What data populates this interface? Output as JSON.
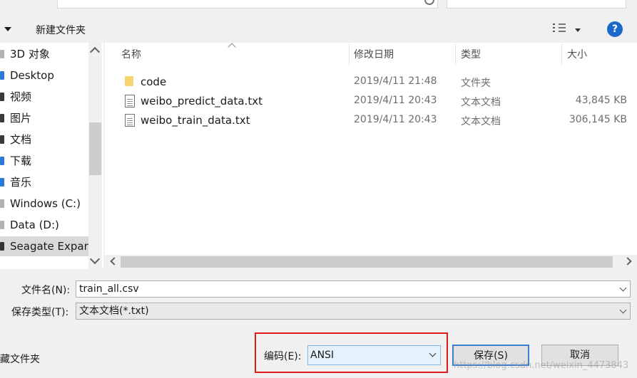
{
  "toolbar": {
    "new_folder_label": "新建文件夹",
    "help_label": "?"
  },
  "nav": {
    "items": [
      {
        "label": "3D 对象"
      },
      {
        "label": "Desktop"
      },
      {
        "label": "视频"
      },
      {
        "label": "图片"
      },
      {
        "label": "文档"
      },
      {
        "label": "下载"
      },
      {
        "label": "音乐"
      },
      {
        "label": "Windows (C:)"
      },
      {
        "label": "Data (D:)"
      },
      {
        "label": "Seagate Expans"
      }
    ],
    "selected": "Seagate Expans"
  },
  "columns": {
    "name": "名称",
    "date": "修改日期",
    "type": "类型",
    "size": "大小"
  },
  "files": [
    {
      "name": "code",
      "date": "2019/4/11 21:48",
      "type": "文件夹",
      "size": "",
      "icon": "folder-icon"
    },
    {
      "name": "weibo_predict_data.txt",
      "date": "2019/4/11 20:43",
      "type": "文本文档",
      "size": "43,845 KB",
      "icon": "text-file-icon"
    },
    {
      "name": "weibo_train_data.txt",
      "date": "2019/4/11 20:43",
      "type": "文本文档",
      "size": "306,145 KB",
      "icon": "text-file-icon"
    }
  ],
  "form": {
    "filename_label": "文件名(N):",
    "filename_value": "train_all.csv",
    "filetype_label": "保存类型(T):",
    "filetype_value": "文本文档(*.txt)",
    "hide_folders_label": "藏文件夹",
    "encoding_label": "编码(E):",
    "encoding_value": "ANSI",
    "save_label": "保存(S)",
    "cancel_label": "取消"
  },
  "watermark": "https://blog.csdn.net/weixin_4473843"
}
